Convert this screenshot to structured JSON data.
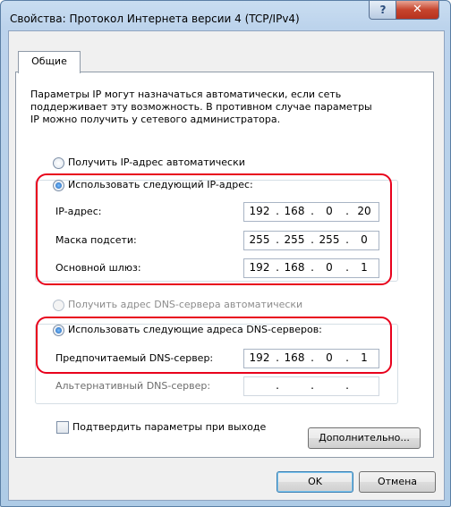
{
  "window": {
    "title": "Свойства: Протокол Интернета версии 4 (TCP/IPv4)",
    "help_glyph": "?",
    "close_glyph": "✕"
  },
  "tabs": [
    {
      "label": "Общие"
    }
  ],
  "description": "Параметры IP могут назначаться автоматически, если сеть\nподдерживает эту возможность. В противном случае параметры\nIP можно получить у сетевого администратора.",
  "ip": {
    "auto_label": "Получить IP-адрес автоматически",
    "manual_label": "Использовать следующий IP-адрес:",
    "selected": "manual",
    "fields": [
      {
        "label": "IP-адрес:",
        "octets": [
          "192",
          "168",
          "0",
          "20"
        ]
      },
      {
        "label": "Маска подсети:",
        "octets": [
          "255",
          "255",
          "255",
          "0"
        ]
      },
      {
        "label": "Основной шлюз:",
        "octets": [
          "192",
          "168",
          "0",
          "1"
        ]
      }
    ]
  },
  "dns": {
    "auto_label": "Получить адрес DNS-сервера автоматически",
    "manual_label": "Использовать следующие адреса DNS-серверов:",
    "selected": "manual",
    "fields": [
      {
        "label": "Предпочитаемый DNS-сервер:",
        "octets": [
          "192",
          "168",
          "0",
          "1"
        ]
      },
      {
        "label": "Альтернативный DNS-сервер:",
        "octets": [
          "",
          "",
          "",
          ""
        ]
      }
    ]
  },
  "dot": ".",
  "validate_label": "Подтвердить параметры при выходе",
  "validate_checked": false,
  "advanced_label": "Дополнительно...",
  "ok_label": "OK",
  "cancel_label": "Отмена",
  "colors": {
    "highlight": "#e8001c",
    "title_bar": "#bcd3ec",
    "close_button": "#c6442d"
  }
}
